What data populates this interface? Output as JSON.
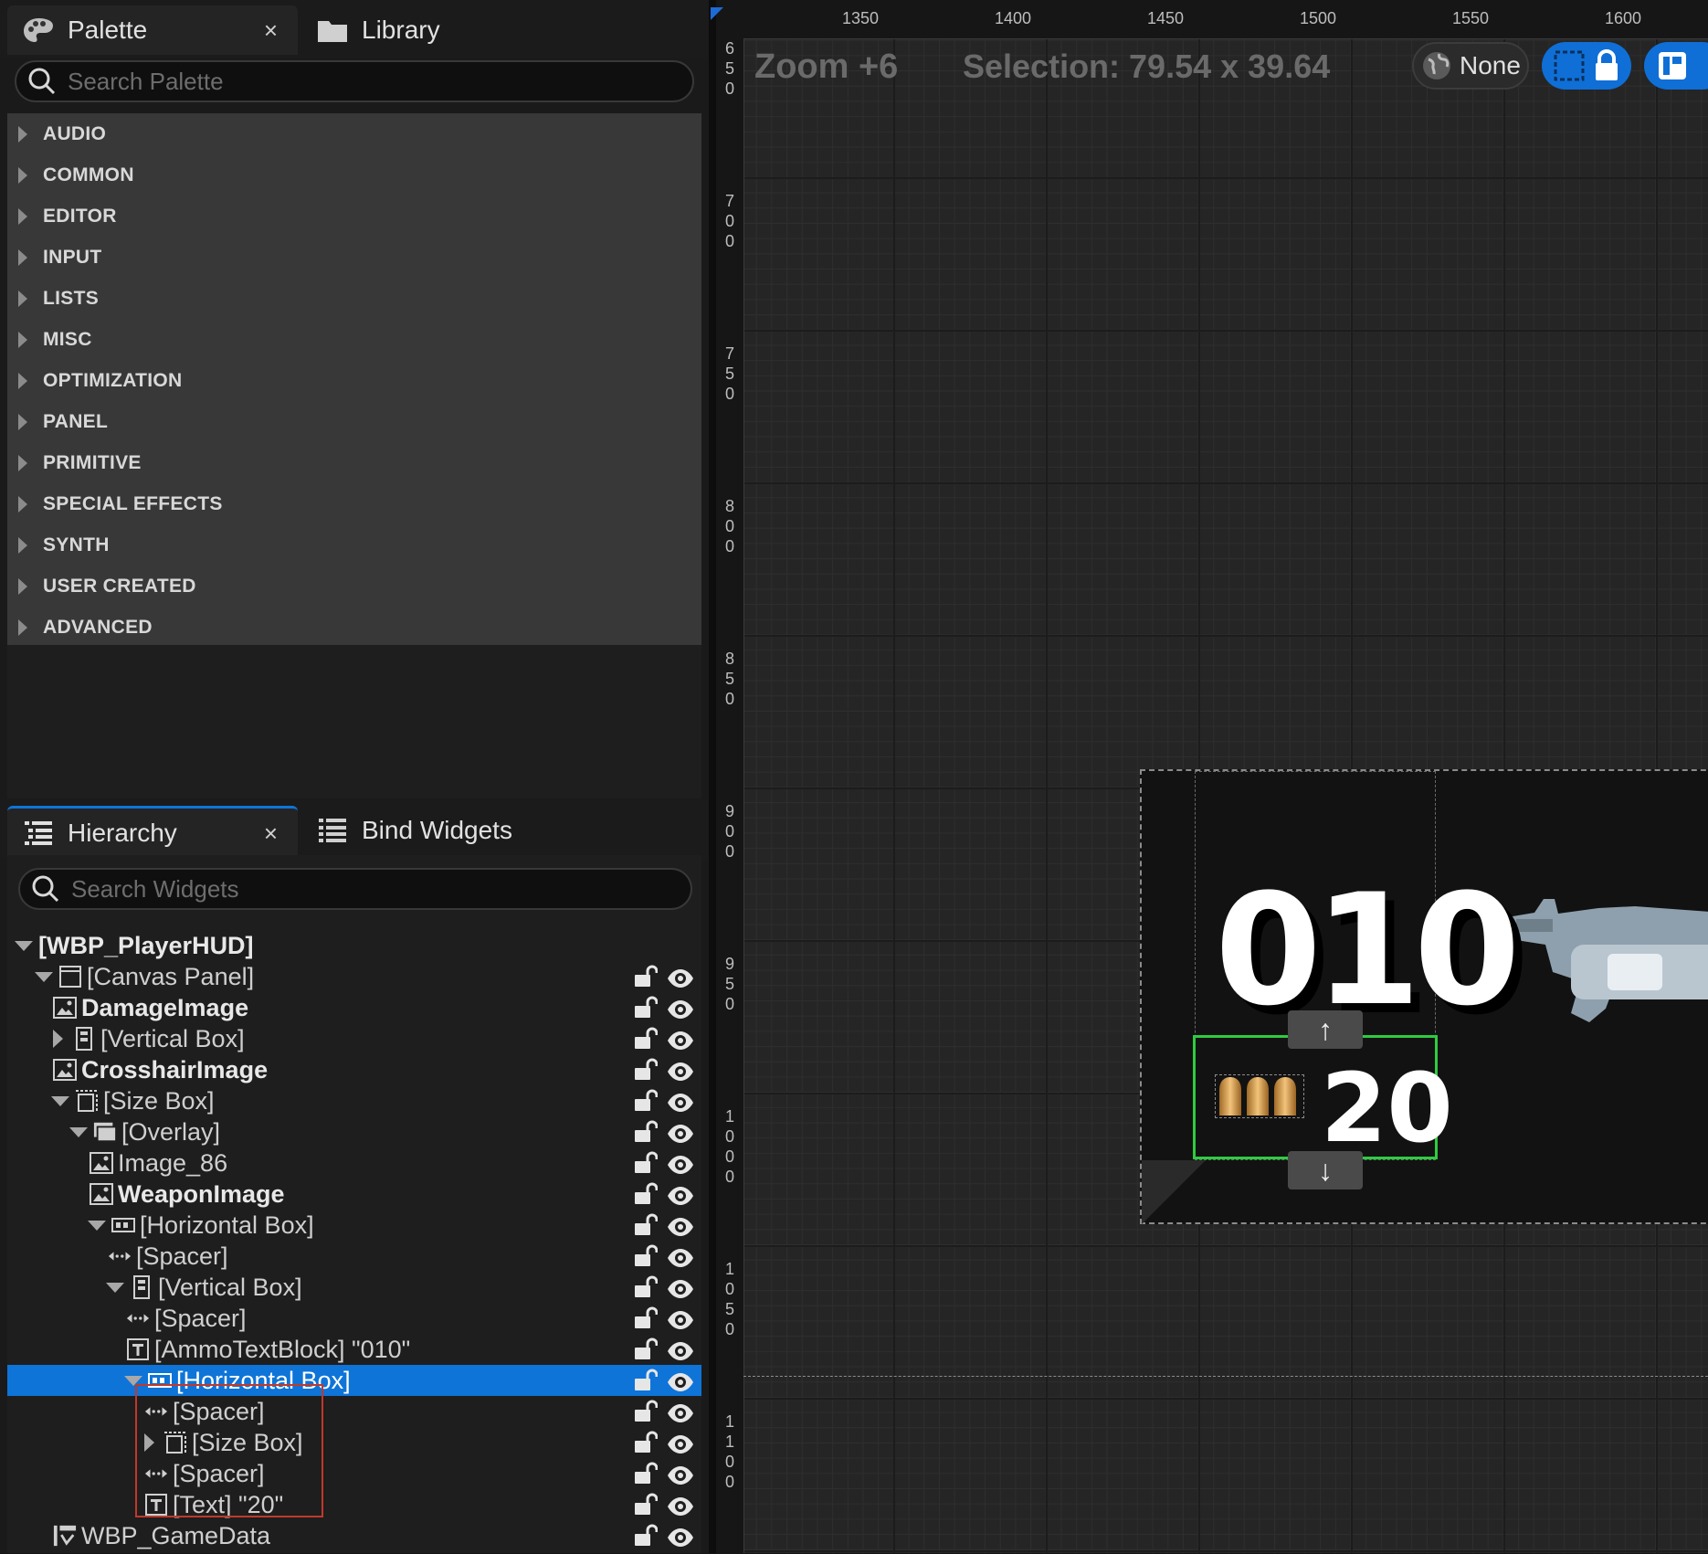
{
  "palette_panel": {
    "tab_palette": "Palette",
    "tab_library": "Library",
    "close_glyph": "×",
    "search_placeholder": "Search Palette",
    "categories": [
      "AUDIO",
      "COMMON",
      "EDITOR",
      "INPUT",
      "LISTS",
      "MISC",
      "OPTIMIZATION",
      "PANEL",
      "PRIMITIVE",
      "SPECIAL EFFECTS",
      "SYNTH",
      "USER CREATED",
      "ADVANCED"
    ]
  },
  "hierarchy_panel": {
    "tab_hierarchy": "Hierarchy",
    "tab_bind_widgets": "Bind Widgets",
    "close_glyph": "×",
    "search_placeholder": "Search Widgets",
    "root": "[WBP_PlayerHUD]",
    "rows": [
      {
        "label": "[Canvas Panel]",
        "icon": "canvas-icon"
      },
      {
        "label": "DamageImage",
        "icon": "image-icon"
      },
      {
        "label": "[Vertical Box]",
        "icon": "vertical-box-icon"
      },
      {
        "label": "CrosshairImage",
        "icon": "image-icon"
      },
      {
        "label": "[Size Box]",
        "icon": "size-box-icon"
      },
      {
        "label": "[Overlay]",
        "icon": "overlay-icon"
      },
      {
        "label": "Image_86",
        "icon": "image-icon"
      },
      {
        "label": "WeaponImage",
        "icon": "image-icon"
      },
      {
        "label": "[Horizontal Box]",
        "icon": "horizontal-box-icon"
      },
      {
        "label": "[Spacer]",
        "icon": "spacer-icon"
      },
      {
        "label": "[Vertical Box]",
        "icon": "vertical-box-icon"
      },
      {
        "label": "[Spacer]",
        "icon": "spacer-icon"
      },
      {
        "label": "[AmmoTextBlock] \"010\"",
        "icon": "text-icon"
      },
      {
        "label": "[Horizontal Box]",
        "icon": "horizontal-box-icon"
      },
      {
        "label": "[Spacer]",
        "icon": "spacer-icon"
      },
      {
        "label": "[Size Box]",
        "icon": "size-box-icon"
      },
      {
        "label": "[Spacer]",
        "icon": "spacer-icon"
      },
      {
        "label": "[Text] \"20\"",
        "icon": "text-icon"
      },
      {
        "label": "WBP_GameData",
        "icon": "user-widget-icon"
      }
    ]
  },
  "designer": {
    "zoom_label": "Zoom +6",
    "selection_label": "Selection: 79.54 x 39.64",
    "localization_value": "None",
    "ruler_top": [
      "1350",
      "1400",
      "1450",
      "1500",
      "1550",
      "1600"
    ],
    "ruler_left": [
      "650",
      "700",
      "750",
      "800",
      "850",
      "900",
      "950",
      "1000",
      "1050",
      "1100"
    ],
    "preview": {
      "ammo_text": "010",
      "reserve_text": "20",
      "nudge_up": "↑",
      "nudge_down": "↓"
    }
  },
  "colors": {
    "selection_blue": "#0e74d8",
    "selection_green": "#2ecc40",
    "annotation_red": "#c0392b"
  }
}
